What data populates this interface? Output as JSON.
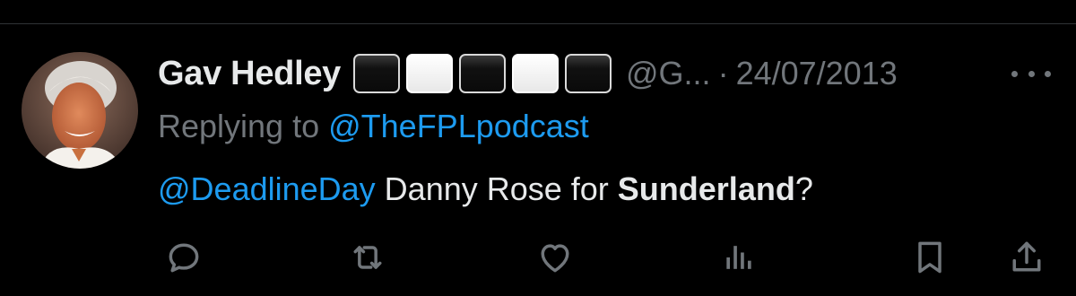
{
  "tweet": {
    "display_name": "Gav Hedley",
    "handle": "@G...",
    "separator": "·",
    "date": "24/07/2013",
    "replying_prefix": "Replying to ",
    "replying_to": "@TheFPLpodcast",
    "mention": "@DeadlineDay",
    "text_middle": " Danny Rose for ",
    "text_bold": "Sunderland",
    "text_end": "?"
  },
  "name_flag_squares": [
    "black",
    "white",
    "black",
    "white",
    "black"
  ],
  "action_icons": [
    "reply-icon",
    "retweet-icon",
    "like-icon",
    "views-icon",
    "bookmark-icon",
    "share-icon"
  ],
  "colors": {
    "background": "#000000",
    "primary_text": "#e7e9ea",
    "secondary_text": "#71767b",
    "link": "#1d9bf0",
    "divider": "#2f3336"
  }
}
